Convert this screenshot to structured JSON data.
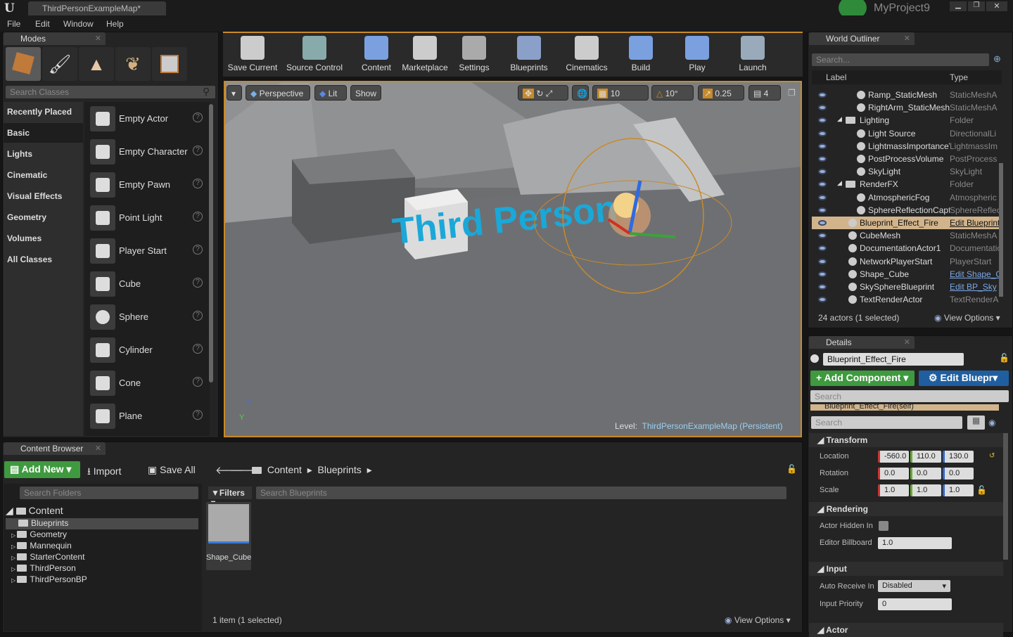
{
  "app": {
    "project": "MyProject9",
    "doc_tab": "ThirdPersonExampleMap*"
  },
  "menu": [
    "File",
    "Edit",
    "Window",
    "Help"
  ],
  "modes": {
    "tab": "Modes",
    "search_placeholder": "Search Classes",
    "categories": [
      "Recently Placed",
      "Basic",
      "Lights",
      "Cinematic",
      "Visual Effects",
      "Geometry",
      "Volumes",
      "All Classes"
    ],
    "selected_category": "Basic",
    "items": [
      "Empty Actor",
      "Empty Character",
      "Empty Pawn",
      "Point Light",
      "Player Start",
      "Cube",
      "Sphere",
      "Cylinder",
      "Cone",
      "Plane"
    ]
  },
  "toolbar": [
    "Save Current",
    "Source Control",
    "Content",
    "Marketplace",
    "Settings",
    "Blueprints",
    "Cinematics",
    "Build",
    "Play",
    "Launch"
  ],
  "viewport": {
    "perspective": "Perspective",
    "lit": "Lit",
    "show": "Show",
    "grid": "10",
    "rot": "10°",
    "scale": "0.25",
    "speed": "4",
    "level_label": "Level:",
    "level_name": "ThirdPersonExampleMap (Persistent)",
    "text_actor": "Third Person"
  },
  "outliner": {
    "tab": "World Outliner",
    "search_placeholder": "Search...",
    "col_label": "Label",
    "col_type": "Type",
    "rows": [
      {
        "label": "Ramp_StaticMesh",
        "type": "StaticMeshA",
        "indent": 2
      },
      {
        "label": "RightArm_StaticMesh",
        "type": "StaticMeshA",
        "indent": 2
      },
      {
        "label": "Lighting",
        "type": "Folder",
        "indent": 1,
        "folder": true
      },
      {
        "label": "Light Source",
        "type": "DirectionalLi",
        "indent": 2
      },
      {
        "label": "LightmassImportanceVolume",
        "type": "LightmassIm",
        "indent": 2
      },
      {
        "label": "PostProcessVolume",
        "type": "PostProcess",
        "indent": 2
      },
      {
        "label": "SkyLight",
        "type": "SkyLight",
        "indent": 2
      },
      {
        "label": "RenderFX",
        "type": "Folder",
        "indent": 1,
        "folder": true
      },
      {
        "label": "AtmosphericFog",
        "type": "Atmospheric",
        "indent": 2
      },
      {
        "label": "SphereReflectionCapture",
        "type": "SphereReflec",
        "indent": 2
      },
      {
        "label": "Blueprint_Effect_Fire",
        "type": "Edit Blueprint",
        "indent": 1,
        "selected": true,
        "link": true
      },
      {
        "label": "CubeMesh",
        "type": "StaticMeshA",
        "indent": 1
      },
      {
        "label": "DocumentationActor1",
        "type": "Documentation",
        "indent": 1
      },
      {
        "label": "NetworkPlayerStart",
        "type": "PlayerStart",
        "indent": 1
      },
      {
        "label": "Shape_Cube",
        "type": "Edit Shape_Cube",
        "indent": 1,
        "link": true
      },
      {
        "label": "SkySphereBlueprint",
        "type": "Edit BP_Sky",
        "indent": 1,
        "link": true
      },
      {
        "label": "TextRenderActor",
        "type": "TextRenderA",
        "indent": 1
      }
    ],
    "status": "24 actors (1 selected)",
    "view_options": "View Options"
  },
  "details": {
    "tab": "Details",
    "name": "Blueprint_Effect_Fire",
    "add_component": "+ Add Component",
    "edit_blueprint": "Edit Bluepr",
    "search_placeholder": "Search",
    "component": "Blueprint_Effect_Fire(self)",
    "transform": {
      "title": "Transform",
      "location_label": "Location",
      "location": [
        "-560.0",
        "110.0",
        "130.0"
      ],
      "rotation_label": "Rotation",
      "rotation": [
        "0.0",
        "0.0",
        "0.0"
      ],
      "scale_label": "Scale",
      "scale": [
        "1.0",
        "1.0",
        "1.0"
      ]
    },
    "rendering": {
      "title": "Rendering",
      "hidden_label": "Actor Hidden In",
      "hidden": false,
      "billboard_label": "Editor Billboard",
      "billboard": "1.0"
    },
    "input": {
      "title": "Input",
      "auto_label": "Auto Receive In",
      "auto": "Disabled",
      "priority_label": "Input Priority",
      "priority": "0"
    },
    "actor_title": "Actor"
  },
  "content": {
    "tab": "Content Browser",
    "add_new": "Add New",
    "import": "Import",
    "save_all": "Save All",
    "path": [
      "Content",
      "Blueprints"
    ],
    "search_folders": "Search Folders",
    "filters": "Filters",
    "search_assets": "Search Blueprints",
    "root": "Content",
    "folders": [
      "Blueprints",
      "Geometry",
      "Mannequin",
      "StarterContent",
      "ThirdPerson",
      "ThirdPersonBP"
    ],
    "selected_folder": "Blueprints",
    "assets": [
      "Shape_Cube"
    ],
    "status": "1 item (1 selected)",
    "view_options": "View Options"
  },
  "colors": {
    "accent_green": "#3f9a3f",
    "accent_blue": "#1f5fa0",
    "selection": "#d2b48c",
    "orange": "#c88a2a"
  }
}
